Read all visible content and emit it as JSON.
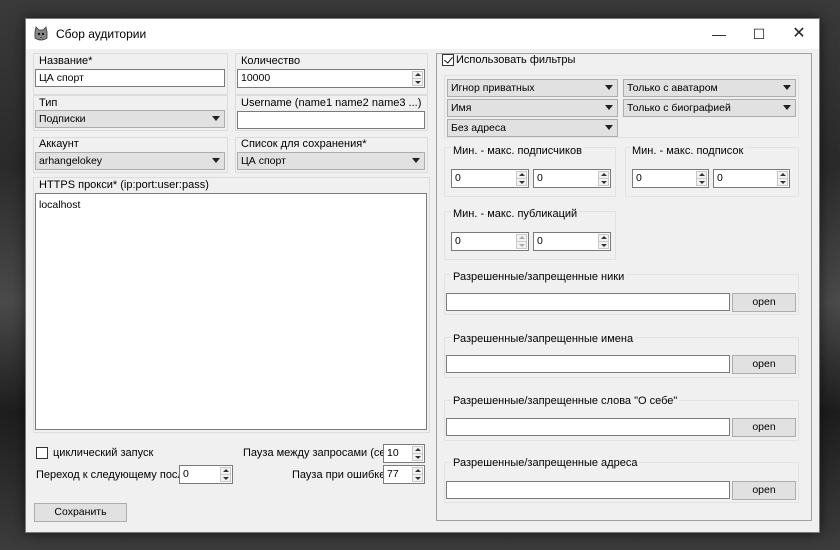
{
  "window": {
    "title": "Сбор аудитории",
    "minimize": "—",
    "maximize": "☐",
    "close": "✕"
  },
  "left": {
    "name_label": "Название*",
    "name_value": "ЦА спорт",
    "count_label": "Количество",
    "count_value": "10000",
    "type_label": "Тип",
    "type_value": "Подписки",
    "usernames_label": "Username (name1 name2 name3 ...)",
    "usernames_value": "",
    "account_label": "Аккаунт",
    "account_value": "arhangelokey",
    "savelist_label": "Список для сохранения*",
    "savelist_value": "ЦА спорт",
    "proxy_label": "HTTPS прокси* (ip:port:user:pass)",
    "proxy_value": "localhost",
    "cyclic_label": "циклический запуск",
    "cyclic_checked": false,
    "pause_label": "Пауза между запросами (сек)",
    "pause_value": "10",
    "next_after_label": "Переход к следующему после",
    "next_after_value": "0",
    "error_pause_label": "Пауза при ошибке",
    "error_pause_value": "77",
    "save_button": "Сохранить"
  },
  "filters": {
    "use_filters_label": "Использовать фильтры",
    "use_filters_checked": true,
    "combo_private": "Игнор приватных",
    "combo_avatar": "Только с аватаром",
    "combo_name": "Имя",
    "combo_bio": "Только с биографией",
    "combo_address": "Без адреса",
    "followers_label": "Мин. - макс. подписчиков",
    "followers_min": "0",
    "followers_max": "0",
    "following_label": "Мин. - макс. подписок",
    "following_min": "0",
    "following_max": "0",
    "posts_label": "Мин. - макс. публикаций",
    "posts_min": "0",
    "posts_max": "0",
    "nicks_label": "Разрешенные/запрещенные ники",
    "names_label": "Разрешенные/запрещенные имена",
    "bio_words_label": "Разрешенные/запрещенные слова \"О себе\"",
    "addresses_label": "Разрешенные/запрещенные адреса",
    "open_label": "open"
  }
}
